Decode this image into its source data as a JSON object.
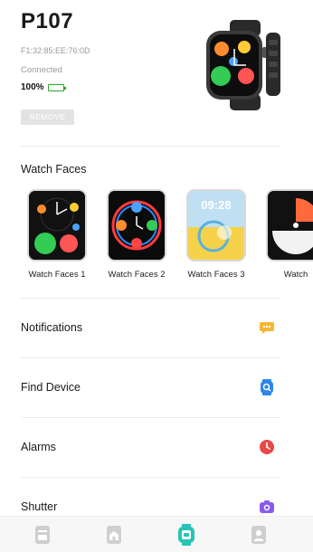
{
  "device": {
    "name": "P107",
    "mac": "F1:32:85:EE:76:0D",
    "status": "Connected",
    "battery_percent": "100%",
    "battery_level": 1.0,
    "remove_label": "REMOVE"
  },
  "watch_faces": {
    "title": "Watch Faces",
    "items": [
      {
        "label": "Watch Faces 1"
      },
      {
        "label": "Watch Faces 2"
      },
      {
        "label": "Watch Faces 3",
        "time": "09:28"
      },
      {
        "label": "Watch"
      }
    ]
  },
  "menu": [
    {
      "label": "Notifications",
      "icon": "message-icon",
      "color": "#f7b731"
    },
    {
      "label": "Find Device",
      "icon": "find-device-icon",
      "color": "#2f86e8"
    },
    {
      "label": "Alarms",
      "icon": "alarm-icon",
      "color": "#e84848"
    },
    {
      "label": "Shutter",
      "icon": "camera-icon",
      "color": "#8a5be8"
    }
  ],
  "tabs": [
    {
      "name": "tab-device-list",
      "icon": "list-card-icon",
      "active": false
    },
    {
      "name": "tab-home",
      "icon": "home-icon",
      "active": false
    },
    {
      "name": "tab-watch",
      "icon": "watch-icon",
      "active": true
    },
    {
      "name": "tab-profile",
      "icon": "profile-icon",
      "active": false
    }
  ],
  "colors": {
    "active_tab": "#27c4b6",
    "inactive_tab": "#cfcfcf",
    "battery": "#2fc02f"
  }
}
